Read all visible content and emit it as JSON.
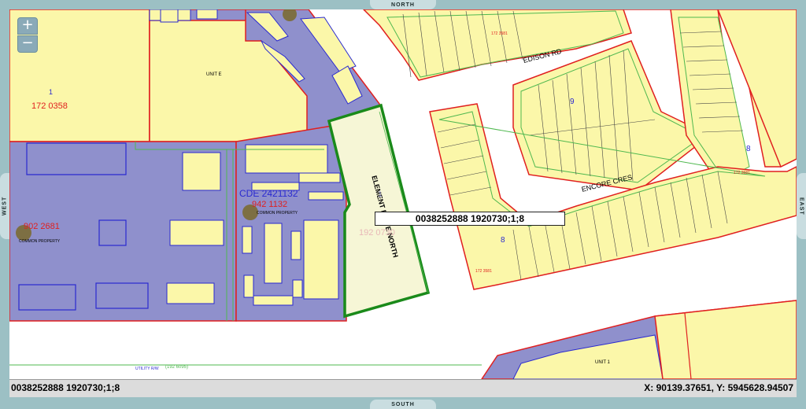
{
  "navigation": {
    "north": "NORTH",
    "south": "SOUTH",
    "west": "WEST",
    "east": "EAST",
    "zoom_in": "+",
    "zoom_out": "−"
  },
  "popup": {
    "text": "0038252888 1920730;1;8"
  },
  "status": {
    "selected": "0038252888 1920730;1;8",
    "coordinates": "X: 90139.37651, Y: 5945628.94507"
  },
  "labels": {
    "road_edison": "EDISON RD",
    "road_element": "ELEMENT DRIVE NORTH",
    "road_encore": "ENCORE CRES",
    "plan_cde": "CDE 2421132",
    "plan_942": "942 1132",
    "plan_902": "902 2681",
    "plan_172_0358": "172 0358",
    "plan_192_0730": "192 0730",
    "common_property_1": "COMMON PROPERTY",
    "common_property_2": "COMMON PROPERTY",
    "unit_e": "UNIT E",
    "unit_1": "UNIT 1",
    "utility_row": "UTILITY R/W",
    "utility_plan": "(192 6095)",
    "block_9": "9",
    "block_8_right": "8",
    "block_8_left": "8",
    "parcel_1": "1",
    "parcel_1_top": "1",
    "plan_172_3581": "172 3581",
    "plan_172_3581_b": "172 3581",
    "plan_172_3581_c": "172 3581"
  },
  "colors": {
    "parcel_yellow": "#fbf7a9",
    "commercial_purple": "#8f90cc",
    "road_white": "#ffffff",
    "boundary_red": "#e01f1f",
    "easement_green": "#4fb84f",
    "selected_green": "#1a8a1a",
    "building_outline": "#2a2ad0"
  }
}
